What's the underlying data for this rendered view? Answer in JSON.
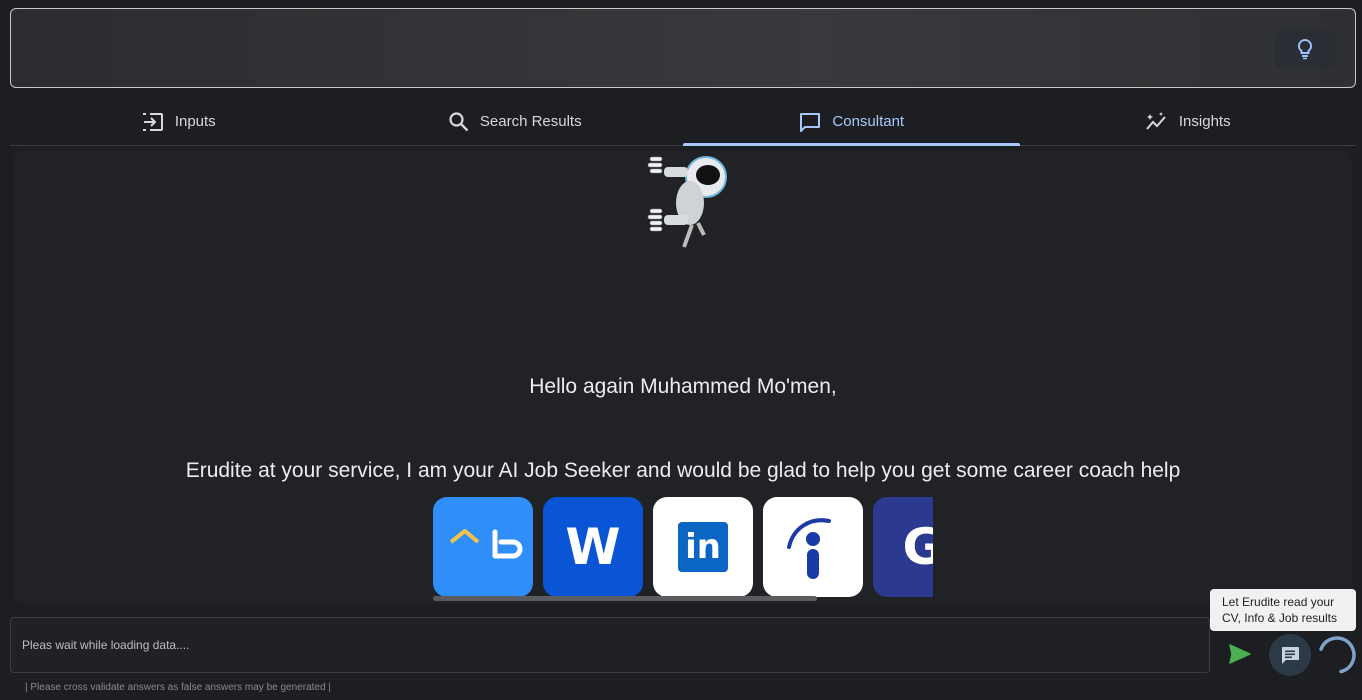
{
  "tabs": [
    {
      "label": "Inputs",
      "icon": "input-icon"
    },
    {
      "label": "Search Results",
      "icon": "search-icon"
    },
    {
      "label": "Consultant",
      "icon": "chat-icon",
      "active": true
    },
    {
      "label": "Insights",
      "icon": "insights-icon"
    }
  ],
  "top_bar": {
    "button_icon": "lightbulb-icon"
  },
  "consultant": {
    "greeting": "Hello again Muhammed Mo'men,",
    "intro": "Erudite at your service, I am your AI Job Seeker and would be glad to help you get some career coach help",
    "mascot": "robot-mascot",
    "logos": [
      {
        "name": "bayt-logo",
        "bg": "#2f8ef7"
      },
      {
        "name": "wuzzuf-logo",
        "bg": "#0a55d6",
        "text": "W"
      },
      {
        "name": "linkedin-logo",
        "bg": "#ffffff",
        "text": "in"
      },
      {
        "name": "indeed-logo",
        "bg": "#ffffff"
      },
      {
        "name": "glassdoor-logo",
        "bg": "#2b3990",
        "text": "G"
      }
    ]
  },
  "chat": {
    "placeholder": "Pleas wait while loading data....",
    "disclaimer": "| Please cross validate answers as false answers may be generated |",
    "tooltip": "Let Erudite read your CV, Info & Job results"
  },
  "colors": {
    "accent": "#a8c7fa",
    "send": "#4caf50",
    "background": "#1c1e22"
  }
}
